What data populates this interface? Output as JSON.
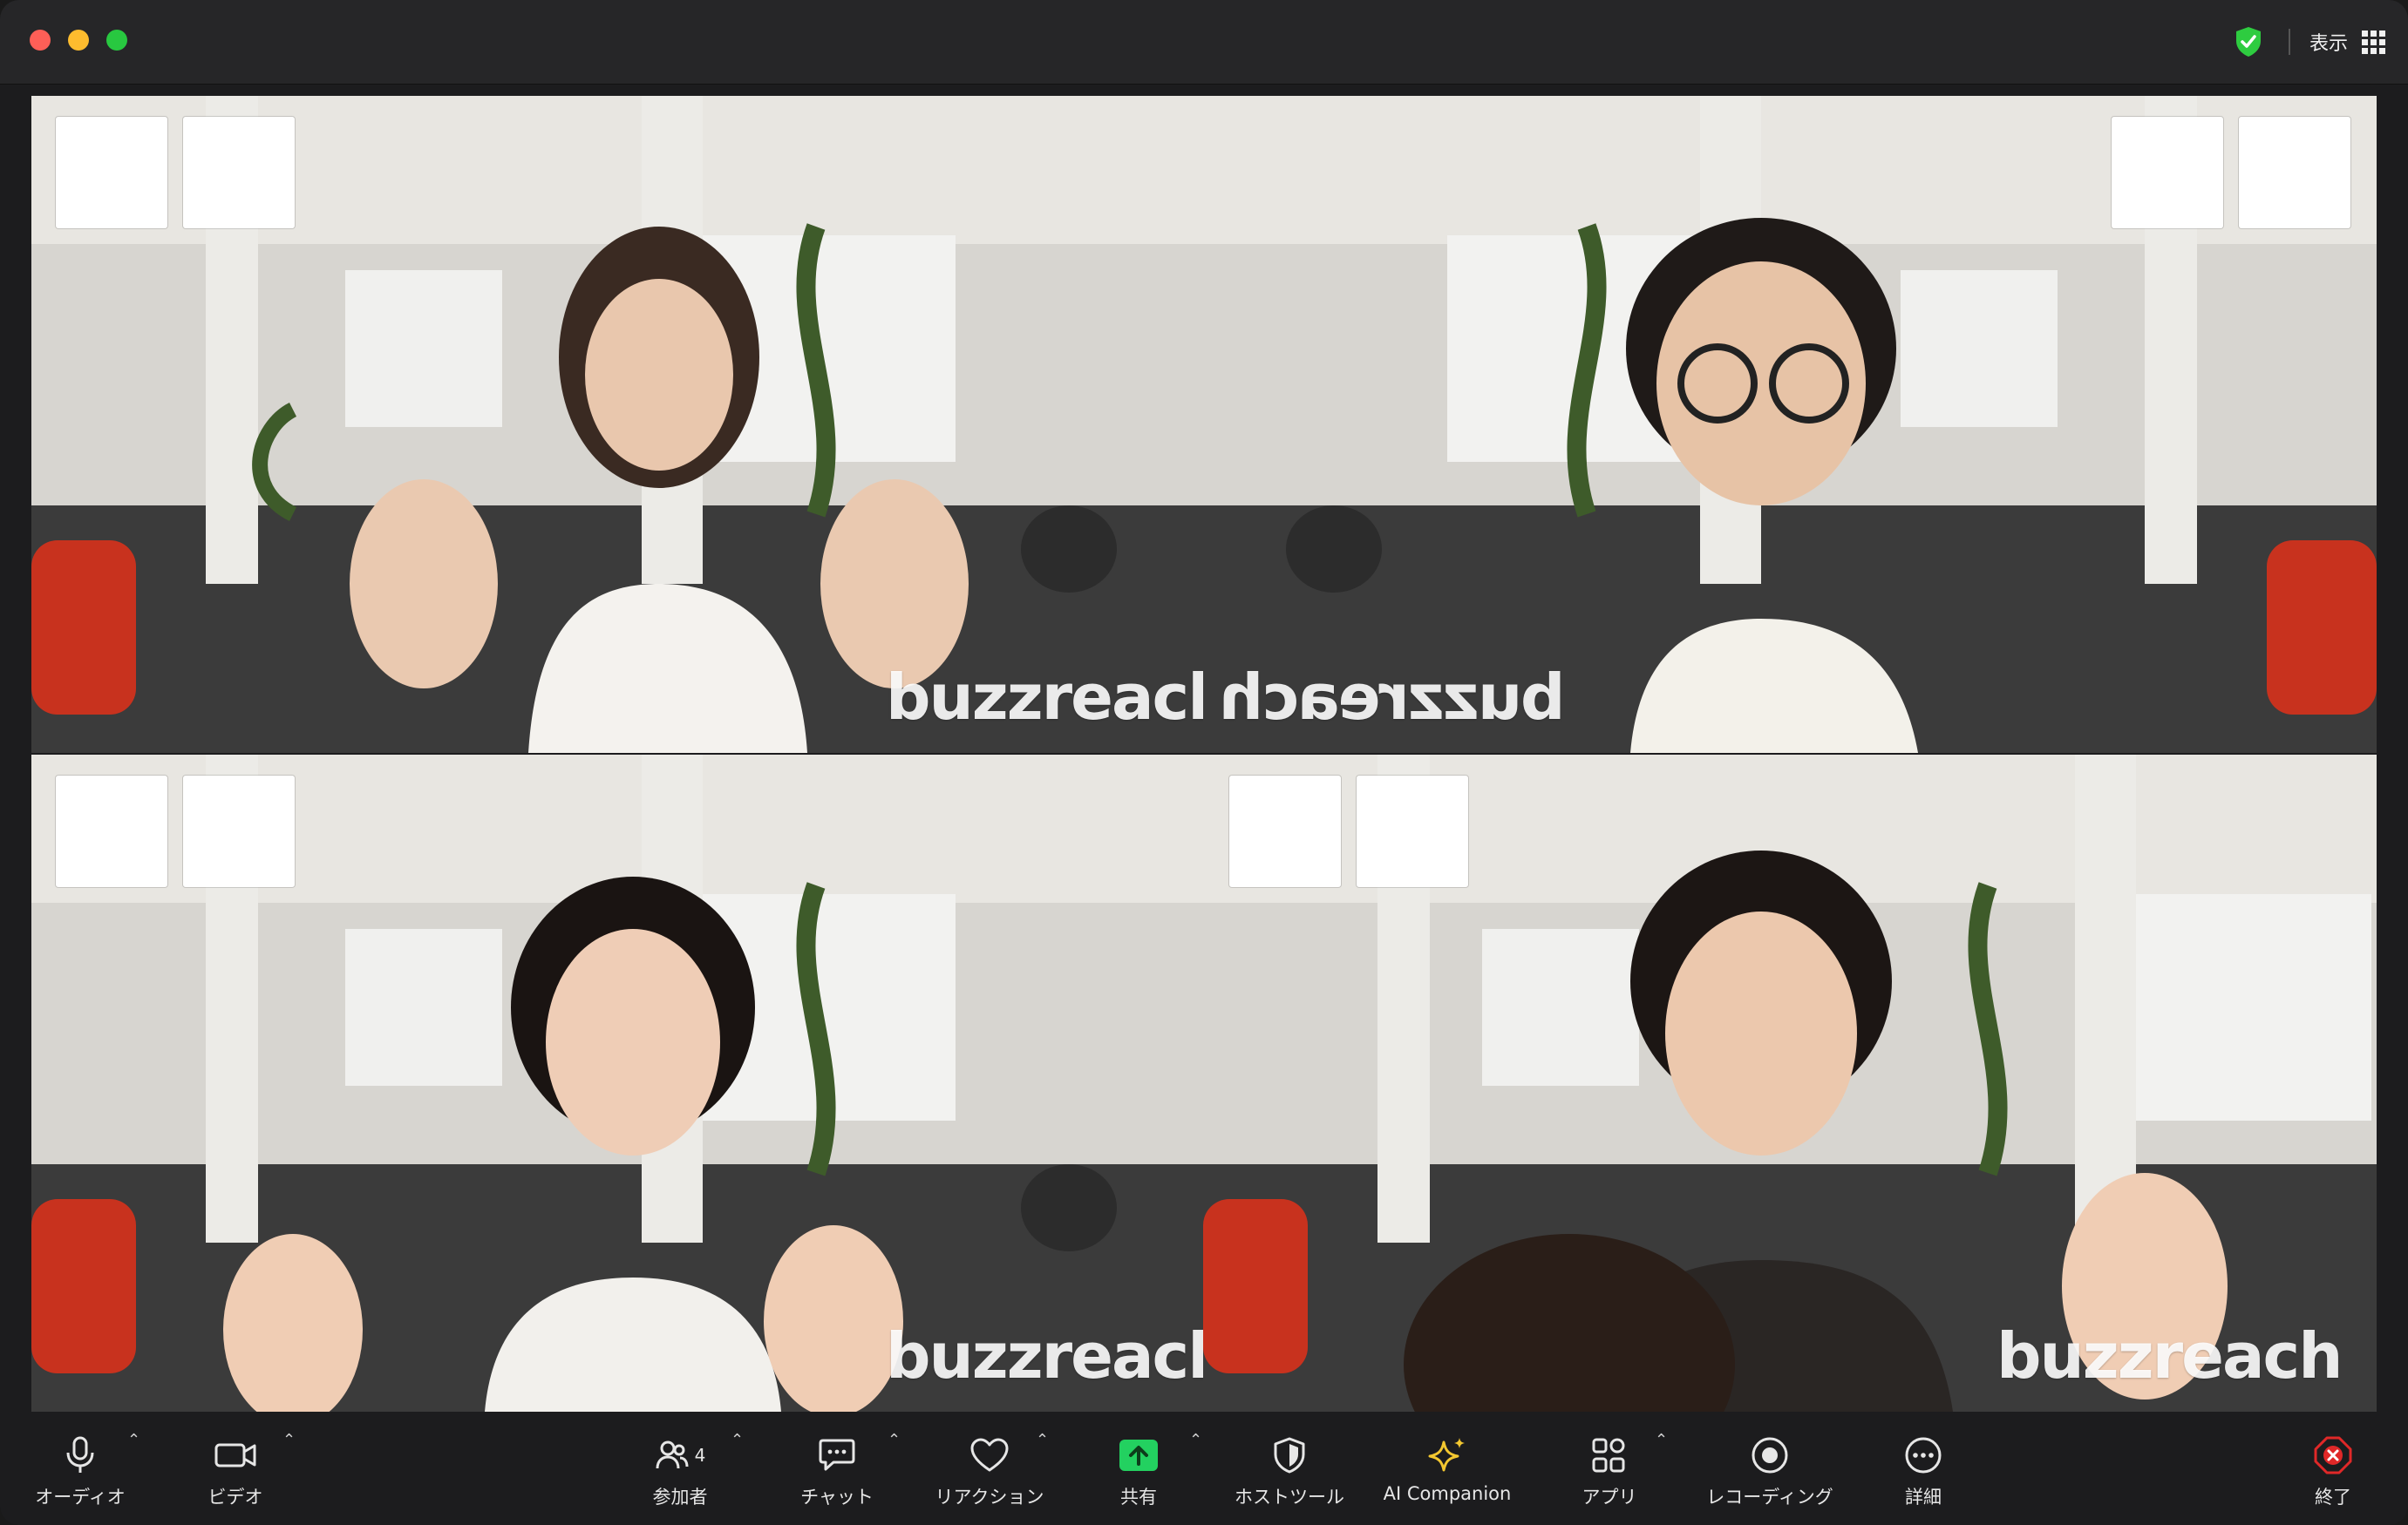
{
  "window": {
    "view_label": "表示"
  },
  "tiles": [
    {
      "name": "participant-tile-1",
      "brand": "buzzreach",
      "active": false
    },
    {
      "name": "participant-tile-2",
      "brand": "buzzreach",
      "active": true
    },
    {
      "name": "participant-tile-3",
      "brand": "buzzreach",
      "active": false
    },
    {
      "name": "participant-tile-4",
      "brand": "buzzreach",
      "active": false
    }
  ],
  "toolbar": {
    "audio_label": "オーディオ",
    "video_label": "ビデオ",
    "participants_label": "参加者",
    "participants_count": "4",
    "chat_label": "チャット",
    "reaction_label": "リアクション",
    "share_label": "共有",
    "host_tools_label": "ホストツール",
    "ai_companion_label": "AI Companion",
    "apps_label": "アプリ",
    "recording_label": "レコーディング",
    "details_label": "詳細",
    "end_label": "終了",
    "share_color": "#23d160",
    "end_color": "#e02828"
  }
}
